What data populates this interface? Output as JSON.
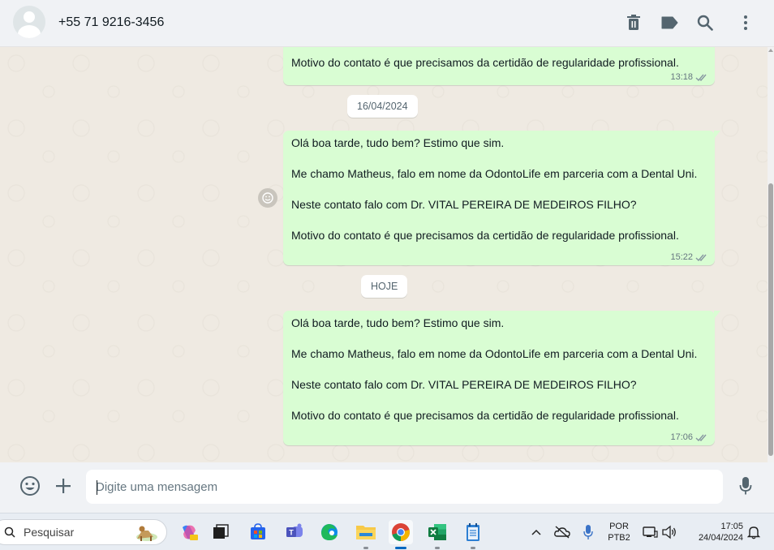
{
  "header": {
    "contact_name": "+55 71 9216-3456",
    "icons": [
      "delete-icon",
      "label-icon",
      "search-icon",
      "menu-dots-icon"
    ]
  },
  "chat": {
    "messages": [
      {
        "lines": [
          "Motivo do contato é que precisamos da certidão de regularidade profissional."
        ],
        "time": "13:18",
        "status": "delivered"
      },
      {
        "lines": [
          "Olá boa tarde, tudo bem? Estimo que sim.",
          "Me chamo Matheus, falo em nome da OdontoLife em parceria com a Dental Uni.",
          "Neste contato falo com Dr. VITAL PEREIRA DE MEDEIROS FILHO?",
          "Motivo do contato é que precisamos da certidão de regularidade profissional."
        ],
        "time": "15:22",
        "status": "delivered"
      },
      {
        "lines": [
          "Olá boa tarde, tudo bem? Estimo que sim.",
          "Me chamo Matheus, falo em nome da OdontoLife em parceria com a Dental Uni.",
          "Neste contato falo com Dr. VITAL PEREIRA DE MEDEIROS FILHO?",
          "Motivo do contato é que precisamos da certidão de regularidade profissional."
        ],
        "time": "17:06",
        "status": "delivered"
      }
    ],
    "date_chips": [
      "16/04/2024",
      "HOJE"
    ]
  },
  "composer": {
    "placeholder": "Digite uma mensagem"
  },
  "taskbar": {
    "search_label": "Pesquisar",
    "apps": [
      "copilot-icon",
      "task-view-icon",
      "store-icon",
      "teams-icon",
      "edge-icon",
      "file-explorer-icon",
      "chrome-icon",
      "excel-icon",
      "notepad-icon"
    ],
    "tray": {
      "lang_top": "POR",
      "lang_bottom": "PTB2",
      "time": "17:05",
      "date": "24/04/2024"
    }
  },
  "colors": {
    "bubble_out": "#d9fdd3",
    "chat_bg": "#efeae2",
    "header_bg": "#f0f2f5",
    "tick": "#8696a0"
  }
}
